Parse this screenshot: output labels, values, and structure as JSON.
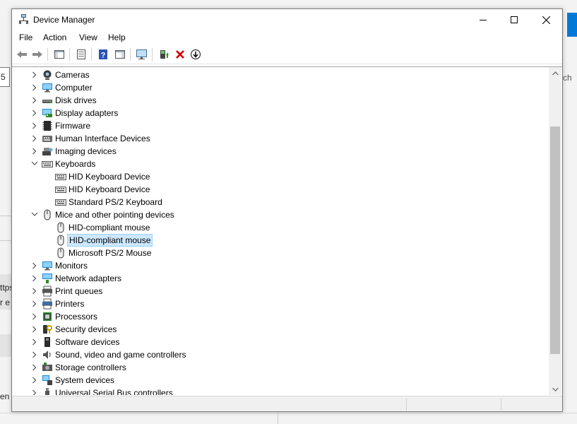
{
  "window": {
    "title": "Device Manager",
    "controls": {
      "minimize": "minimize",
      "maximize": "maximize",
      "close": "close"
    }
  },
  "menu": [
    "File",
    "Action",
    "View",
    "Help"
  ],
  "toolbar": {
    "buttons": [
      "back-icon",
      "forward-icon",
      "show-hide-console-tree-icon",
      "properties-icon",
      "help-icon",
      "action-pane-icon",
      "scan-hardware-icon",
      "update-driver-icon",
      "uninstall-device-icon",
      "disable-device-icon"
    ]
  },
  "background": {
    "frag_left_box": "5",
    "frag_https": "ttps",
    "frag_r_e": "r e",
    "frag_en": "en",
    "frag_ch": "ch"
  },
  "tree": [
    {
      "label": "Cameras",
      "level": 0,
      "expanded": false,
      "icon": "camera-icon"
    },
    {
      "label": "Computer",
      "level": 0,
      "expanded": false,
      "icon": "computer-icon"
    },
    {
      "label": "Disk drives",
      "level": 0,
      "expanded": false,
      "icon": "disk-drive-icon"
    },
    {
      "label": "Display adapters",
      "level": 0,
      "expanded": false,
      "icon": "display-adapter-icon"
    },
    {
      "label": "Firmware",
      "level": 0,
      "expanded": false,
      "icon": "firmware-icon"
    },
    {
      "label": "Human Interface Devices",
      "level": 0,
      "expanded": false,
      "icon": "hid-icon"
    },
    {
      "label": "Imaging devices",
      "level": 0,
      "expanded": false,
      "icon": "imaging-icon"
    },
    {
      "label": "Keyboards",
      "level": 0,
      "expanded": true,
      "icon": "keyboard-icon"
    },
    {
      "label": "HID Keyboard Device",
      "level": 1,
      "icon": "keyboard-icon"
    },
    {
      "label": "HID Keyboard Device",
      "level": 1,
      "icon": "keyboard-icon"
    },
    {
      "label": "Standard PS/2 Keyboard",
      "level": 1,
      "icon": "keyboard-icon"
    },
    {
      "label": "Mice and other pointing devices",
      "level": 0,
      "expanded": true,
      "icon": "mouse-icon"
    },
    {
      "label": "HID-compliant mouse",
      "level": 1,
      "icon": "mouse-icon"
    },
    {
      "label": "HID-compliant mouse",
      "level": 1,
      "icon": "mouse-icon",
      "selected": true
    },
    {
      "label": "Microsoft PS/2 Mouse",
      "level": 1,
      "icon": "mouse-icon"
    },
    {
      "label": "Monitors",
      "level": 0,
      "expanded": false,
      "icon": "monitor-icon"
    },
    {
      "label": "Network adapters",
      "level": 0,
      "expanded": false,
      "icon": "network-adapter-icon"
    },
    {
      "label": "Print queues",
      "level": 0,
      "expanded": false,
      "icon": "print-queue-icon"
    },
    {
      "label": "Printers",
      "level": 0,
      "expanded": false,
      "icon": "printer-icon"
    },
    {
      "label": "Processors",
      "level": 0,
      "expanded": false,
      "icon": "processor-icon"
    },
    {
      "label": "Security devices",
      "level": 0,
      "expanded": false,
      "icon": "security-device-icon"
    },
    {
      "label": "Software devices",
      "level": 0,
      "expanded": false,
      "icon": "software-device-icon"
    },
    {
      "label": "Sound, video and game controllers",
      "level": 0,
      "expanded": false,
      "icon": "sound-icon"
    },
    {
      "label": "Storage controllers",
      "level": 0,
      "expanded": false,
      "icon": "storage-controller-icon"
    },
    {
      "label": "System devices",
      "level": 0,
      "expanded": false,
      "icon": "system-device-icon"
    },
    {
      "label": "Universal Serial Bus controllers",
      "level": 0,
      "expanded": false,
      "icon": "usb-icon"
    }
  ],
  "colors": {
    "selection": "#cce8ff",
    "selection_border": "#99d1ff",
    "accent": "#0078d7"
  }
}
